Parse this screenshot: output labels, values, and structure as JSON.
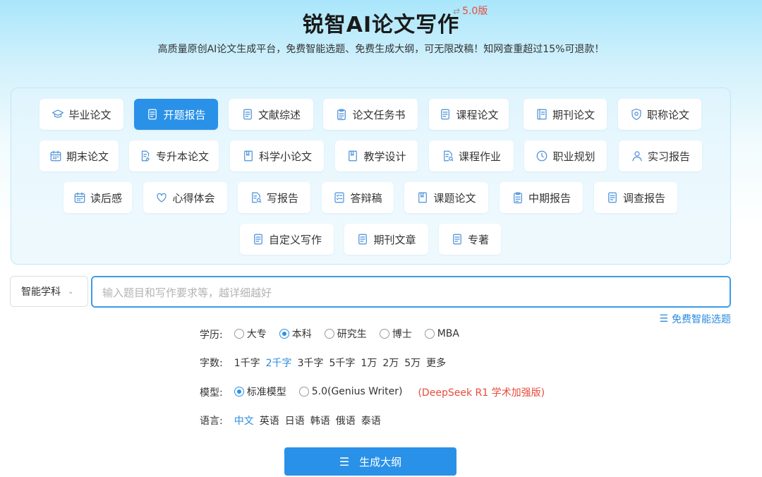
{
  "header": {
    "title": "锐智AI论文写作",
    "version_switch_icon": "swap-icon",
    "version_switch_glyph": "⇄",
    "version": "5.0版",
    "subtitle": "高质量原创AI论文生成平台，免费智能选题、免费生成大纲，可无限改稿！知网查重超过15%可退款！"
  },
  "categories": [
    {
      "label": "毕业论文",
      "icon": "graduation-cap-icon",
      "active": false
    },
    {
      "label": "开题报告",
      "icon": "document-icon",
      "active": true
    },
    {
      "label": "文献综述",
      "icon": "document-icon",
      "active": false
    },
    {
      "label": "论文任务书",
      "icon": "clipboard-icon",
      "active": false
    },
    {
      "label": "课程论文",
      "icon": "document-icon",
      "active": false
    },
    {
      "label": "期刊论文",
      "icon": "journal-icon",
      "active": false
    },
    {
      "label": "职称论文",
      "icon": "badge-icon",
      "active": false
    },
    {
      "label": "期末论文",
      "icon": "calendar-icon",
      "active": false
    },
    {
      "label": "专升本论文",
      "icon": "document-edit-icon",
      "active": false
    },
    {
      "label": "科学小论文",
      "icon": "book-icon",
      "active": false
    },
    {
      "label": "教学设计",
      "icon": "book-icon",
      "active": false
    },
    {
      "label": "课程作业",
      "icon": "document-search-icon",
      "active": false
    },
    {
      "label": "职业规划",
      "icon": "clock-icon",
      "active": false
    },
    {
      "label": "实习报告",
      "icon": "user-icon",
      "active": false
    },
    {
      "label": "读后感",
      "icon": "calendar-icon",
      "active": false
    },
    {
      "label": "心得体会",
      "icon": "heart-icon",
      "active": false
    },
    {
      "label": "写报告",
      "icon": "document-search-icon",
      "active": false
    },
    {
      "label": "答辩稿",
      "icon": "checklist-icon",
      "active": false
    },
    {
      "label": "课题论文",
      "icon": "book-icon",
      "active": false
    },
    {
      "label": "中期报告",
      "icon": "clipboard-icon",
      "active": false
    },
    {
      "label": "调查报告",
      "icon": "document-icon",
      "active": false
    },
    {
      "label": "自定义写作",
      "icon": "document-icon",
      "active": false
    },
    {
      "label": "期刊文章",
      "icon": "document-icon",
      "active": false
    },
    {
      "label": "专著",
      "icon": "document-icon",
      "active": false
    }
  ],
  "form": {
    "subject_select": "智能学科",
    "topic_placeholder": "输入题目和写作要求等，越详细越好",
    "topic_value": "",
    "suggest_label": "免费智能选题",
    "education": {
      "label": "学历:",
      "options": [
        "大专",
        "本科",
        "研究生",
        "博士",
        "MBA"
      ],
      "selected": "本科"
    },
    "wordcount": {
      "label": "字数:",
      "options": [
        "1千字",
        "2千字",
        "3千字",
        "5千字",
        "1万",
        "2万",
        "5万",
        "更多"
      ],
      "selected": "2千字"
    },
    "model": {
      "label": "模型:",
      "options": [
        "标准模型",
        "5.0(Genius Writer)"
      ],
      "selected": "标准模型",
      "note": "(DeepSeek R1 学术加强版)"
    },
    "language": {
      "label": "语言:",
      "options": [
        "中文",
        "英语",
        "日语",
        "韩语",
        "俄语",
        "泰语"
      ],
      "selected": "中文"
    },
    "generate_button": "生成大纲"
  },
  "colors": {
    "accent": "#2a91e8",
    "link": "#2a8be0",
    "warning": "#e84b3c"
  }
}
